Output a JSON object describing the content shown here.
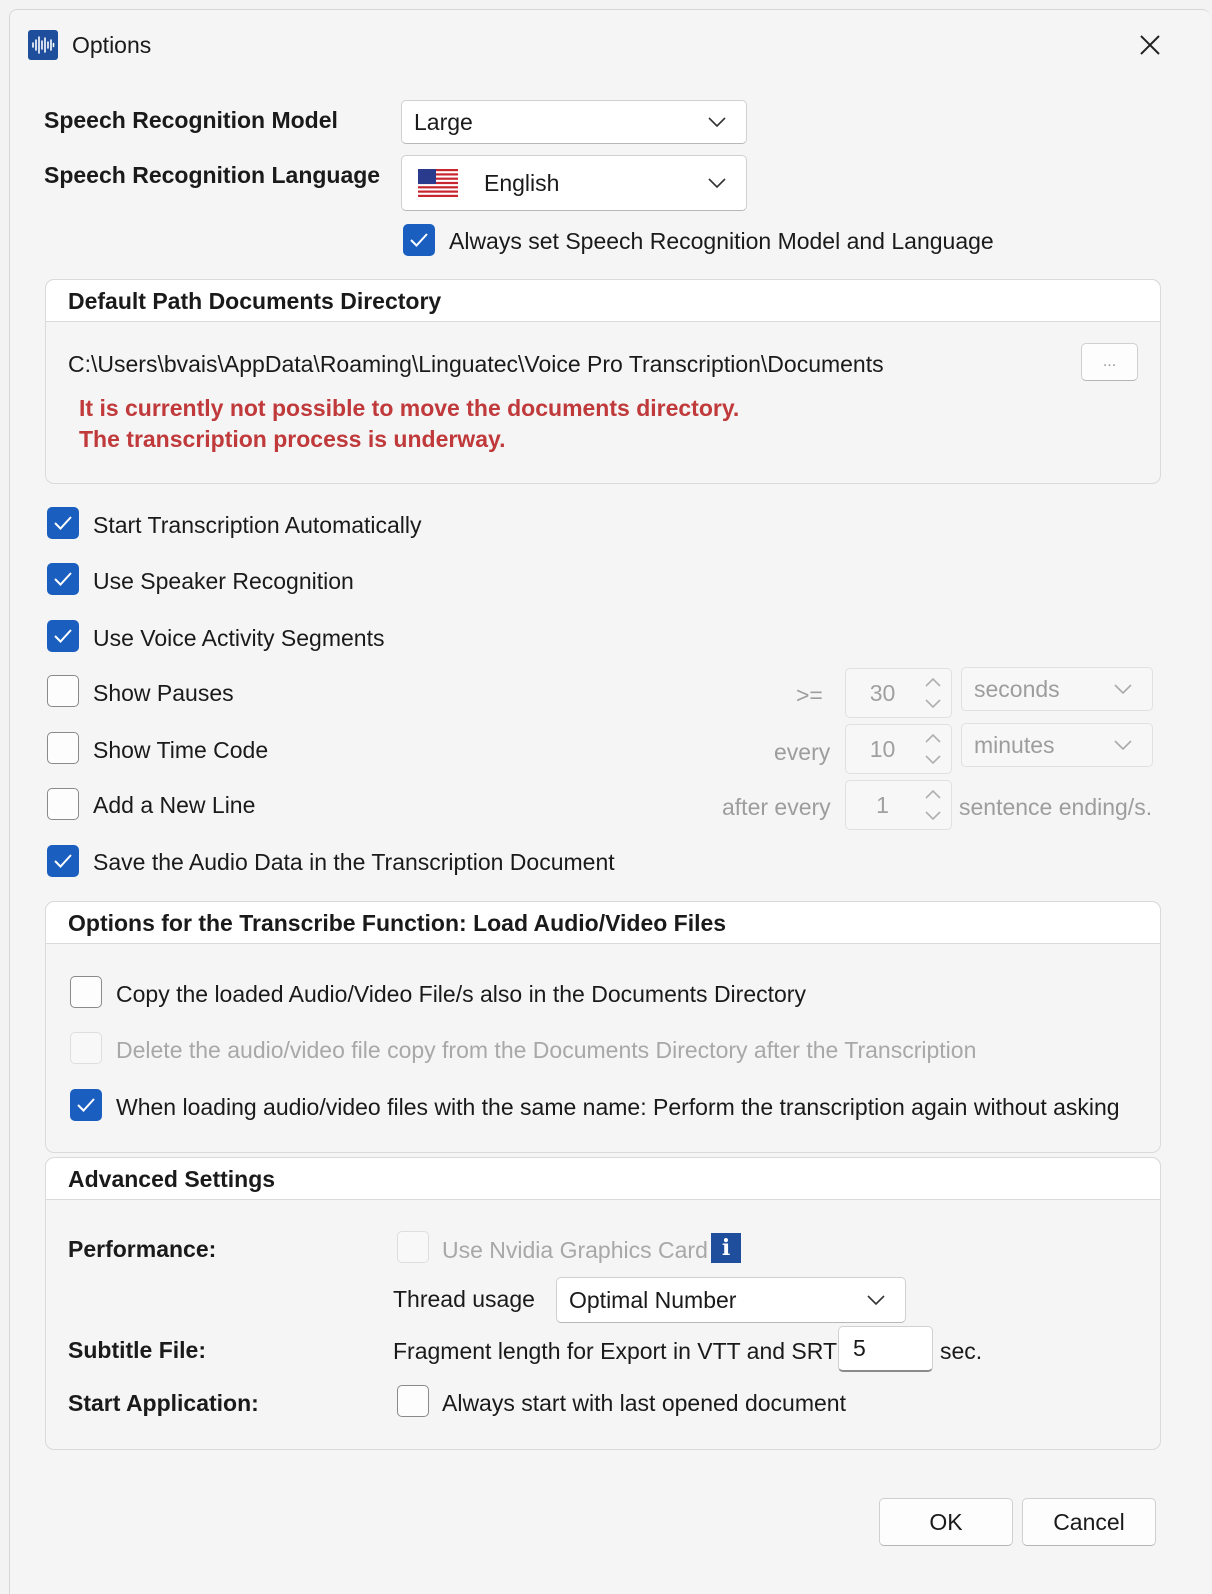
{
  "window": {
    "title": "Options"
  },
  "speech": {
    "model_label": "Speech Recognition Model",
    "model_value": "Large",
    "language_label": "Speech Recognition Language",
    "language_value": "English",
    "always_set_label": "Always set Speech Recognition Model and Language",
    "always_set_checked": true
  },
  "docs_dir": {
    "title": "Default Path Documents Directory",
    "path": "C:\\Users\\bvais\\AppData\\Roaming\\Linguatec\\Voice Pro Transcription\\Documents",
    "browse_label": "...",
    "warning_line1": "It is currently not possible to move the documents directory.",
    "warning_line2": "The transcription process is underway."
  },
  "options": {
    "start_auto": "Start Transcription Automatically",
    "speaker_recognition": "Use Speaker Recognition",
    "voice_activity": "Use Voice Activity Segments",
    "show_pauses": "Show Pauses",
    "pauses_prefix": ">=",
    "pauses_value": "30",
    "pauses_unit": "seconds",
    "show_time_code": "Show Time Code",
    "timecode_prefix": "every",
    "timecode_value": "10",
    "timecode_unit": "minutes",
    "add_new_line": "Add a New Line",
    "newline_prefix": "after every",
    "newline_value": "1",
    "newline_suffix": "sentence ending/s.",
    "save_audio": "Save the Audio Data in the Transcription Document"
  },
  "transcribe": {
    "title": "Options for the Transcribe Function: Load Audio/Video Files",
    "copy_files": "Copy the loaded Audio/Video File/s also in the Documents Directory",
    "delete_copy": "Delete the audio/video file copy from the Documents Directory after the Transcription",
    "same_name": "When loading audio/video files with the same name: Perform the transcription again without asking"
  },
  "advanced": {
    "title": "Advanced Settings",
    "performance_label": "Performance:",
    "nvidia_label": "Use Nvidia Graphics Card",
    "info_glyph": "i",
    "thread_label": "Thread usage",
    "thread_value": "Optimal Number",
    "subtitle_label": "Subtitle File:",
    "fragment_label": "Fragment length for Export in VTT and SRT",
    "fragment_value": "5",
    "fragment_unit": "sec.",
    "start_app_label": "Start Application:",
    "last_doc_label": "Always start with last opened document"
  },
  "buttons": {
    "ok": "OK",
    "cancel": "Cancel"
  },
  "colors": {
    "accent": "#1a5ebf",
    "warning": "#c0393b",
    "app_icon": "#1f4e9c"
  }
}
